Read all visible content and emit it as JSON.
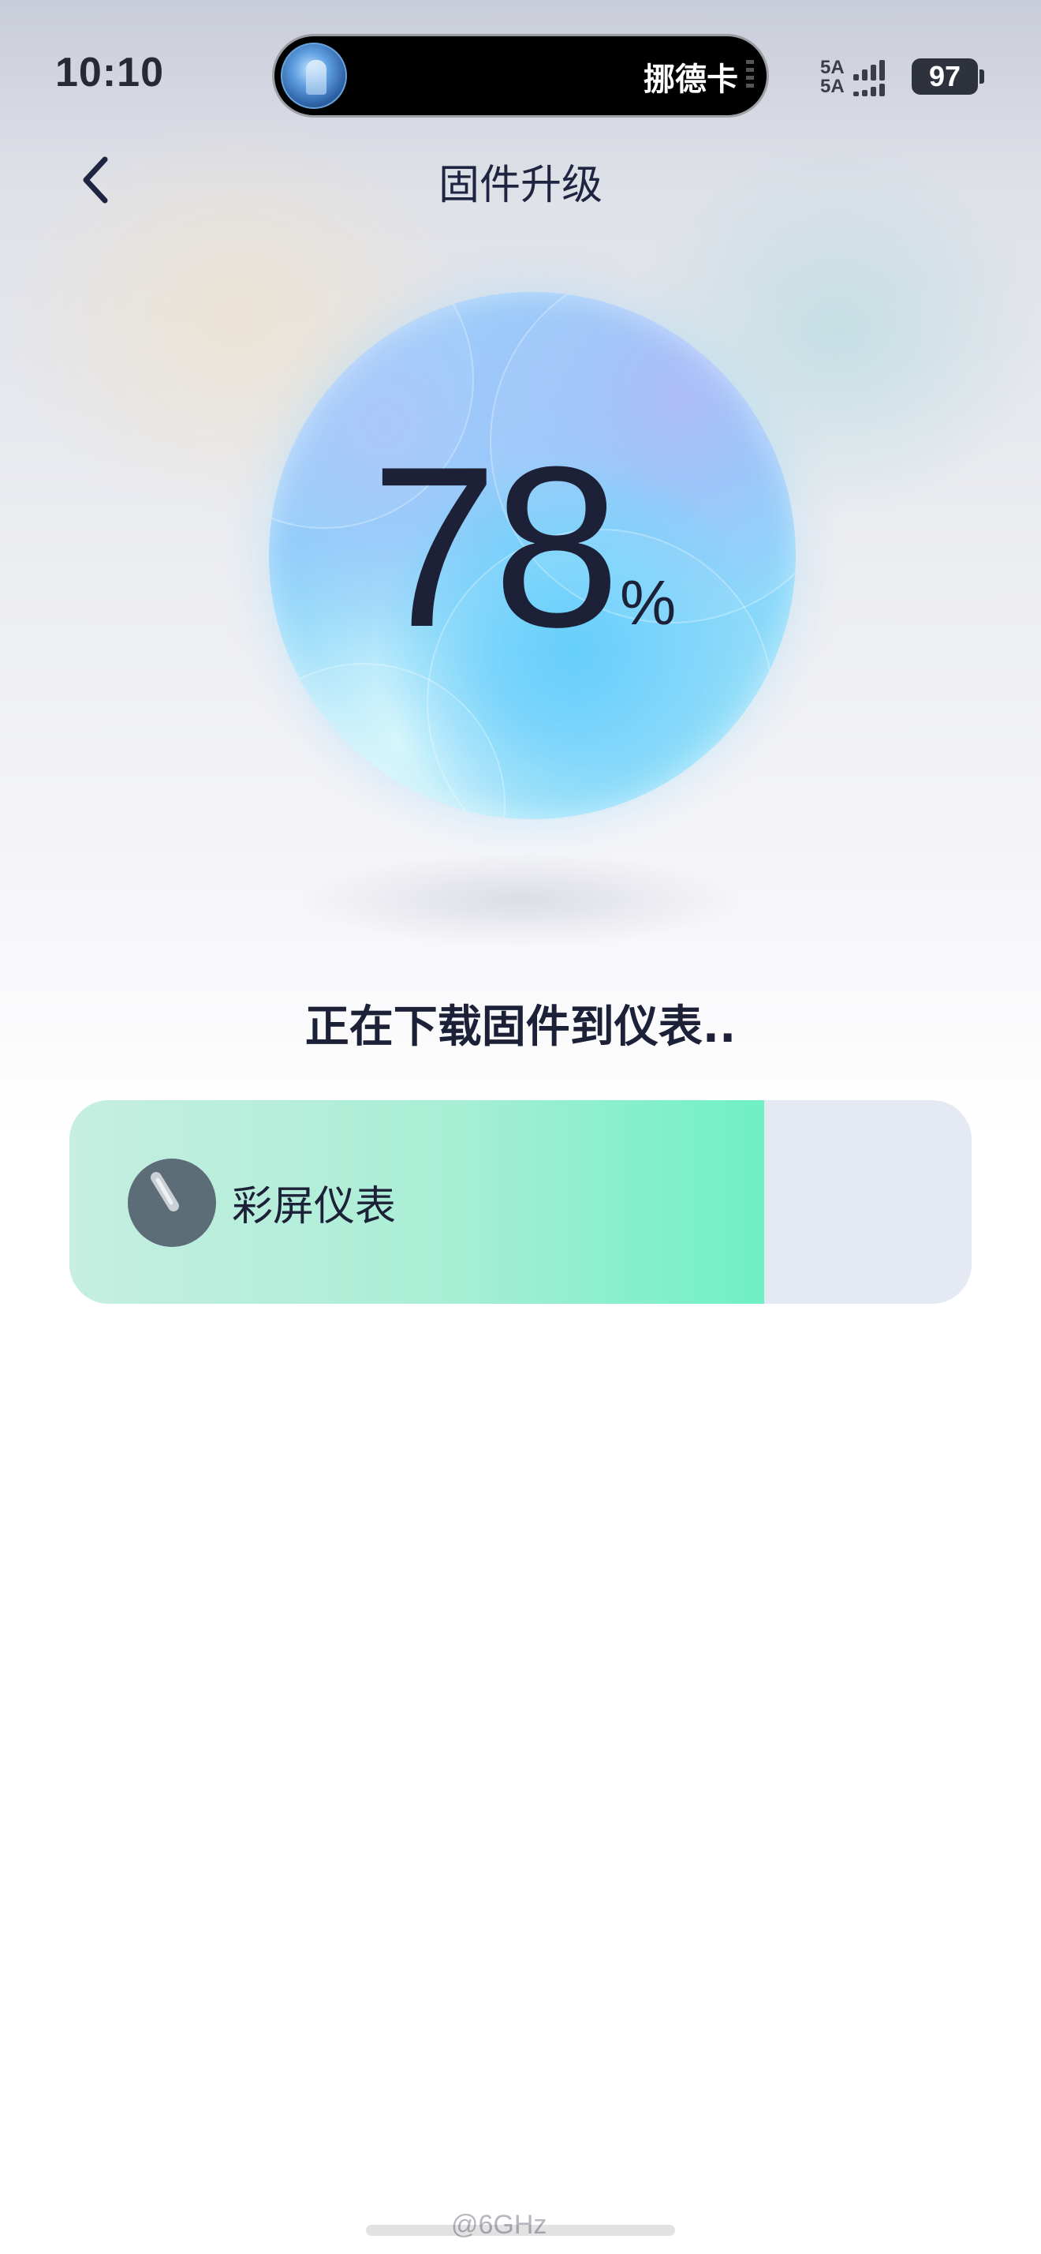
{
  "status_bar": {
    "time": "10:10",
    "island_text": "挪德卡",
    "network_top": "5A",
    "network_bottom": "5A",
    "battery": "97"
  },
  "nav": {
    "title": "固件升级",
    "back_icon": "chevron-left-icon"
  },
  "progress": {
    "value": "78",
    "unit": "%",
    "fraction": 0.78
  },
  "status": {
    "message": "正在下载固件到仪表.."
  },
  "device": {
    "label": "彩屏仪表",
    "icon": "gauge-icon",
    "progress_fraction": 0.77
  },
  "watermark": {
    "text": "@6GHz"
  },
  "colors": {
    "accent_green": "#6ff0c4",
    "orb_blue": "#5ccdfb",
    "text_dark": "#1c2138"
  }
}
